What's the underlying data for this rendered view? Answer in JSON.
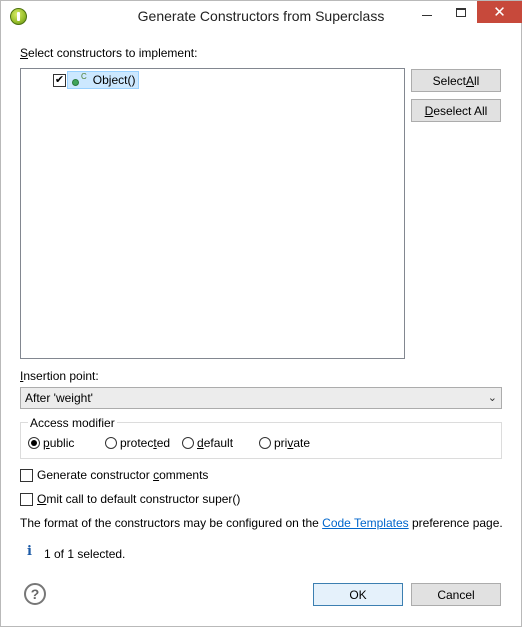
{
  "window": {
    "title": "Generate Constructors from Superclass",
    "minimize_glyph": "—",
    "close_glyph": "✕"
  },
  "constructors": {
    "label_pre": "",
    "label_u": "S",
    "label_post": "elect constructors to implement:",
    "items": [
      {
        "checked": true,
        "checkmark": "✔",
        "label": "Object()",
        "modifier_mark": "C"
      }
    ]
  },
  "buttons": {
    "select_all": {
      "pre": "Select ",
      "u": "A",
      "post": "ll"
    },
    "deselect_all": {
      "pre": "",
      "u": "D",
      "post": "eselect All"
    },
    "ok": "OK",
    "cancel": "Cancel"
  },
  "insertion_point": {
    "label_pre": "",
    "label_u": "I",
    "label_post": "nsertion point:",
    "selected": "After 'weight'",
    "arrow": "⌄"
  },
  "access_modifier": {
    "title": "Access modifier",
    "options": [
      {
        "pre": "",
        "u": "p",
        "post": "ublic",
        "checked": true
      },
      {
        "pre": "protec",
        "u": "t",
        "post": "ed",
        "checked": false
      },
      {
        "pre": "",
        "u": "d",
        "post": "efault",
        "checked": false
      },
      {
        "pre": "pri",
        "u": "v",
        "post": "ate",
        "checked": false
      }
    ]
  },
  "options": {
    "comments": {
      "pre": "Generate constructor ",
      "u": "c",
      "post": "omments",
      "checked": false
    },
    "omit_super": {
      "pre": "",
      "u": "O",
      "post": "mit call to default constructor super()",
      "checked": false
    }
  },
  "footer_note": {
    "pre": "The format of the constructors may be configured on the ",
    "link": "Code Templates",
    "post": " preference page."
  },
  "status": {
    "icon": "i",
    "text": "1 of 1 selected."
  },
  "help": {
    "glyph": "?"
  },
  "colors": {
    "close_bg": "#c7493b",
    "link": "#0066cc",
    "selection": "#cce8ff"
  }
}
